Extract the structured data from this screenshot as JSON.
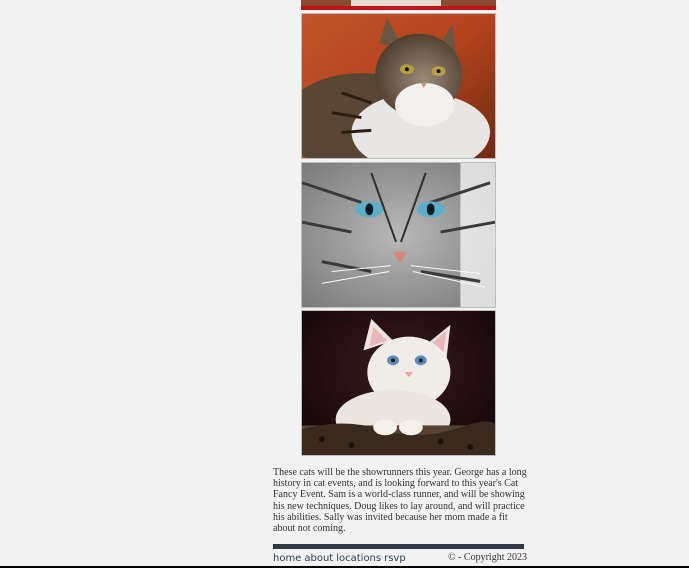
{
  "gallery": {
    "images": [
      {
        "label": "cat-photo-partial"
      },
      {
        "label": "cat-photo-maine-coon"
      },
      {
        "label": "cat-photo-silver-tabby"
      },
      {
        "label": "cat-photo-white-kitten"
      }
    ]
  },
  "caption": {
    "text": "These cats will be the showrunners this year. George has a long history in cat events, and is looking forward to this year's Cat Fancy Event. Sam is a world-class runner, and will be showing his new techniques. Doug likes to lay around, and will practice his abilities. Sally was invited because her mom made a fit about not coming."
  },
  "footer": {
    "nav": {
      "home": "home",
      "about": "about",
      "locations": "locations",
      "rsvp": "rsvp"
    },
    "copyright": "© - Copyright 2023"
  },
  "colors": {
    "background": "#f2f2f2",
    "footer_bar": "#2f3a44",
    "nav_text": "#2c3e50"
  }
}
